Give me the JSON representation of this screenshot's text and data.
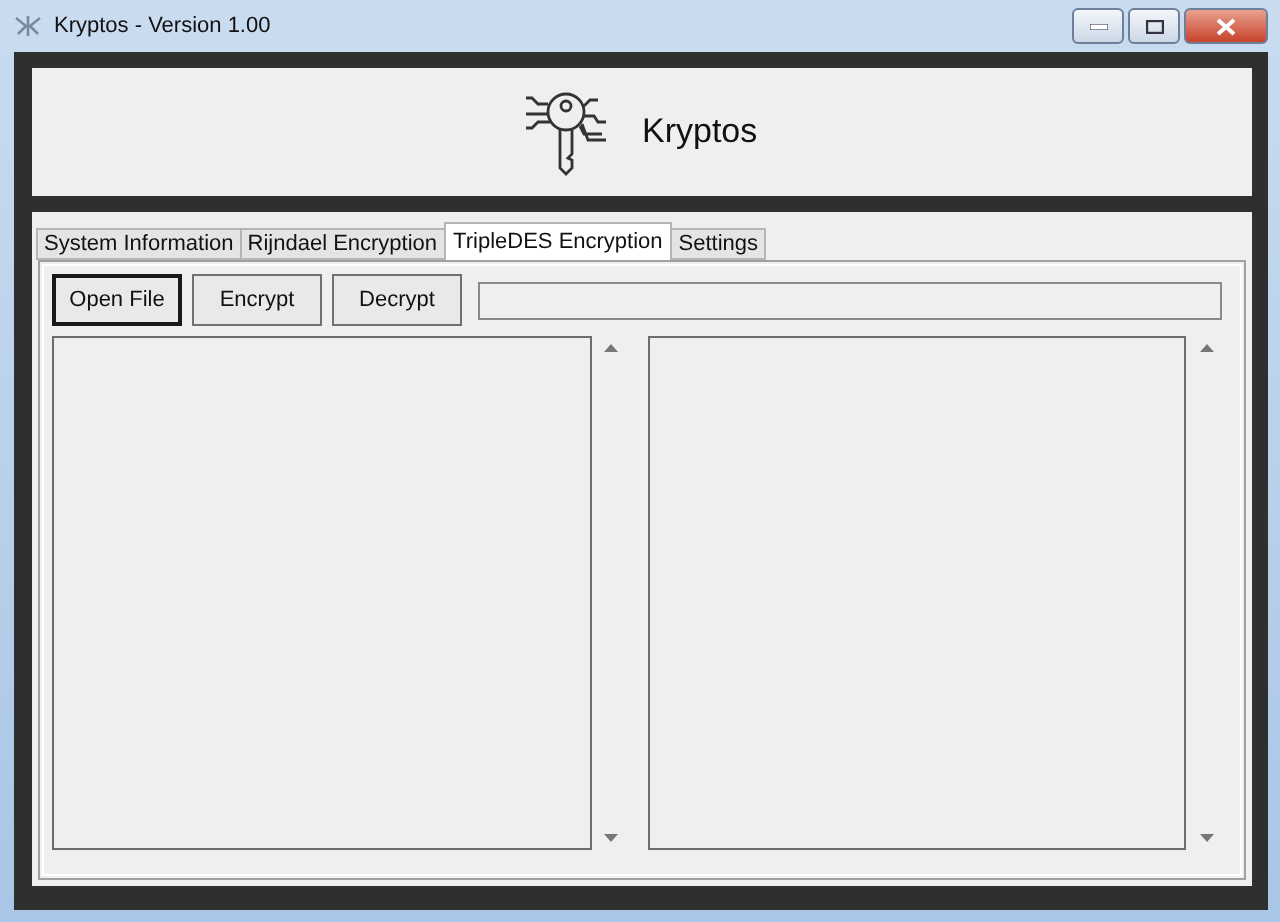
{
  "window": {
    "title": "Kryptos - Version 1.00"
  },
  "header": {
    "app_name": "Kryptos"
  },
  "tabs": [
    {
      "label": "System Information",
      "selected": false
    },
    {
      "label": "Rijndael Encryption",
      "selected": false
    },
    {
      "label": "TripleDES Encryption",
      "selected": true
    },
    {
      "label": "Settings",
      "selected": false
    }
  ],
  "buttons": [
    {
      "label": "Open File",
      "selected": true
    },
    {
      "label": "Encrypt",
      "selected": false
    },
    {
      "label": "Decrypt",
      "selected": false
    }
  ]
}
